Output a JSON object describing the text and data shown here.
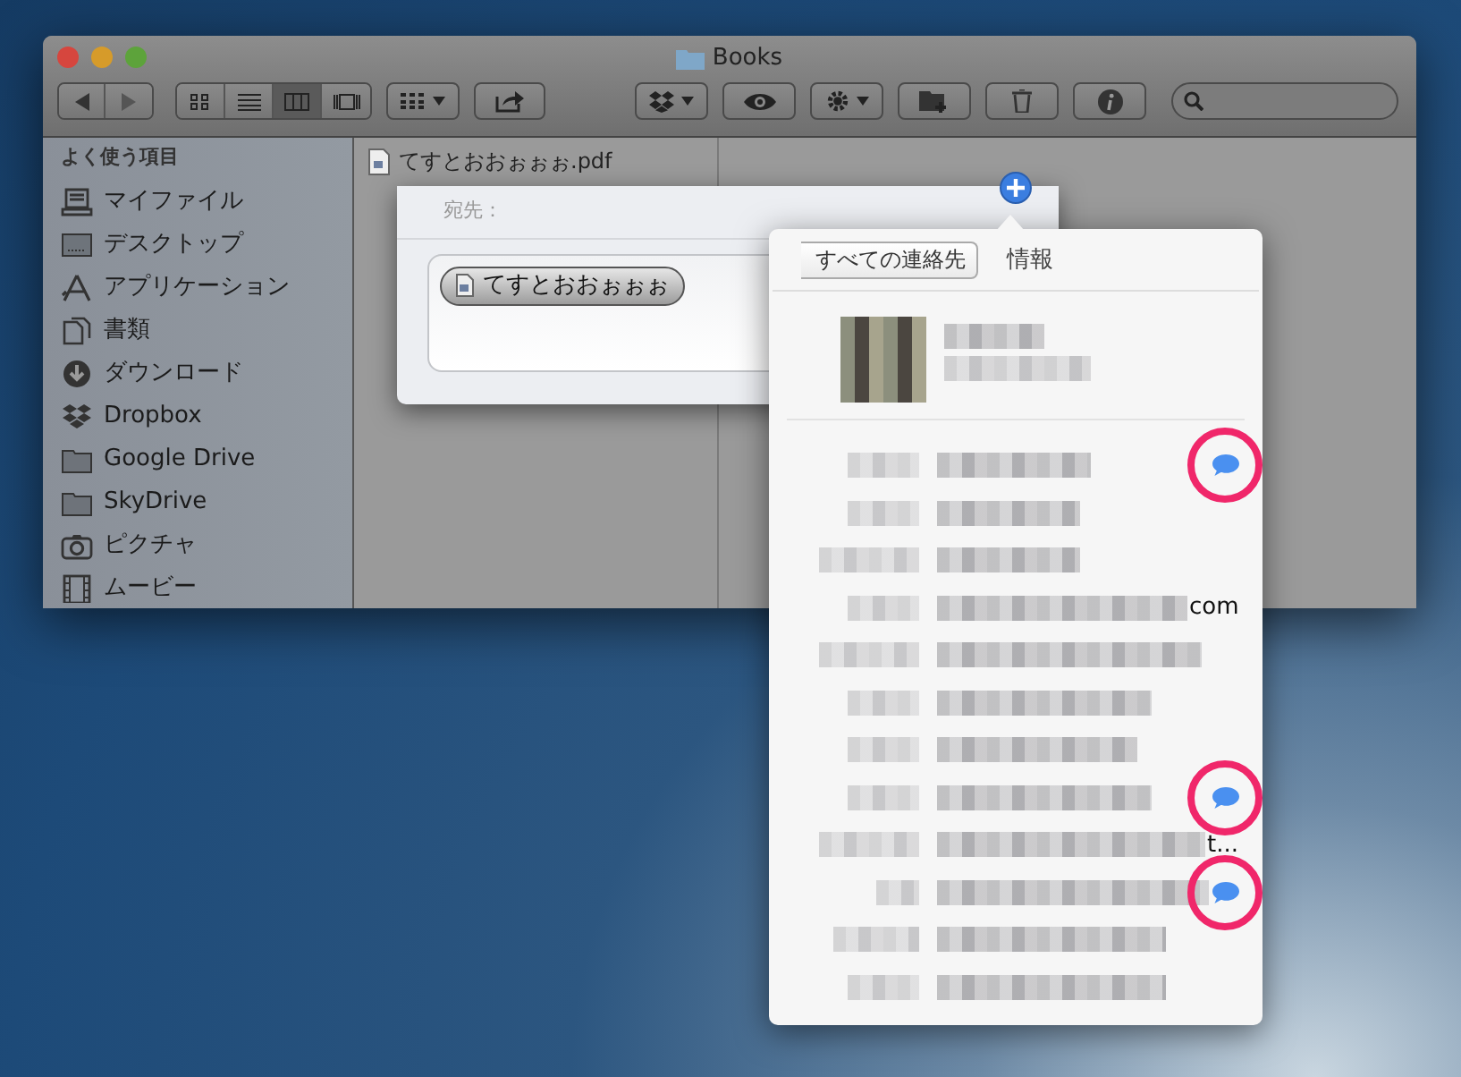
{
  "window": {
    "title": "Books",
    "view_modes": [
      {
        "kind": "icons",
        "selected": false
      },
      {
        "kind": "list",
        "selected": false
      },
      {
        "kind": "columns",
        "selected": true
      },
      {
        "kind": "coverflow",
        "selected": false
      }
    ]
  },
  "sidebar": {
    "heading": "よく使う項目",
    "items": [
      {
        "label": "マイファイル",
        "kind": "allfiles"
      },
      {
        "label": "デスクトップ",
        "kind": "desktop"
      },
      {
        "label": "アプリケーション",
        "kind": "apps"
      },
      {
        "label": "書類",
        "kind": "docs"
      },
      {
        "label": "ダウンロード",
        "kind": "download"
      },
      {
        "label": "Dropbox",
        "kind": "dropbox"
      },
      {
        "label": "Google Drive",
        "kind": "folder"
      },
      {
        "label": "SkyDrive",
        "kind": "folder"
      },
      {
        "label": "ピクチャ",
        "kind": "camera"
      },
      {
        "label": "ムービー",
        "kind": "film"
      }
    ]
  },
  "file": {
    "name": "てすとおおぉぉぉ.pdf"
  },
  "share_sheet": {
    "to_label": "宛先：",
    "recipient": "てすとおおぉぉぉ"
  },
  "contact_popover": {
    "back_button": "すべての連絡先",
    "title": "情報",
    "rows": [
      {
        "message": true
      },
      {
        "message": false
      },
      {
        "message": false
      },
      {
        "message": false,
        "suffix": "com"
      },
      {
        "message": false
      },
      {
        "message": false
      },
      {
        "message": false
      },
      {
        "message": true
      },
      {
        "message": false,
        "suffix": "t..."
      },
      {
        "message": true
      },
      {
        "message": false
      },
      {
        "message": false
      }
    ]
  }
}
